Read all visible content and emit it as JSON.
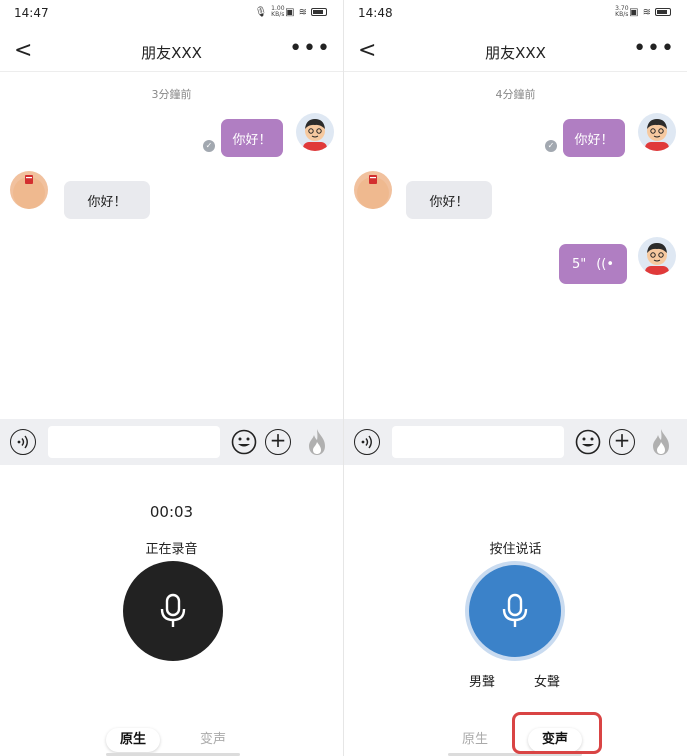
{
  "left": {
    "status": {
      "time": "14:47",
      "net_speed": "1.00 KB/s"
    },
    "nav": {
      "back": "<",
      "title": "朋友XXX",
      "more": "•••"
    },
    "time_label": "3分鐘前",
    "messages": [
      {
        "from": "me",
        "text": "你好！"
      },
      {
        "from": "friend",
        "text": "你好！"
      }
    ],
    "recorder": {
      "timer": "00:03",
      "status": "正在录音"
    },
    "tabs": {
      "original": "原生",
      "voice_change": "变声",
      "active": "original"
    }
  },
  "right": {
    "status": {
      "time": "14:48",
      "net_speed": "3.70 KB/s"
    },
    "nav": {
      "back": "<",
      "title": "朋友XXX",
      "more": "•••"
    },
    "time_label": "4分鐘前",
    "messages": [
      {
        "from": "me",
        "text": "你好！"
      },
      {
        "from": "friend",
        "text": "你好！"
      },
      {
        "from": "me",
        "type": "voice",
        "duration": "5\"",
        "wave_icon": "((•"
      }
    ],
    "recorder": {
      "status": "按住说话"
    },
    "voice_options": {
      "male": "男聲",
      "female": "女聲"
    },
    "tabs": {
      "original": "原生",
      "voice_change": "变声",
      "active": "voice_change"
    }
  },
  "colors": {
    "bubble_me": "#b07ec2",
    "bubble_friend": "#e9eaee",
    "mic_recording": "#222222",
    "mic_voice_change": "#3b82c9",
    "highlight": "#d94444"
  }
}
